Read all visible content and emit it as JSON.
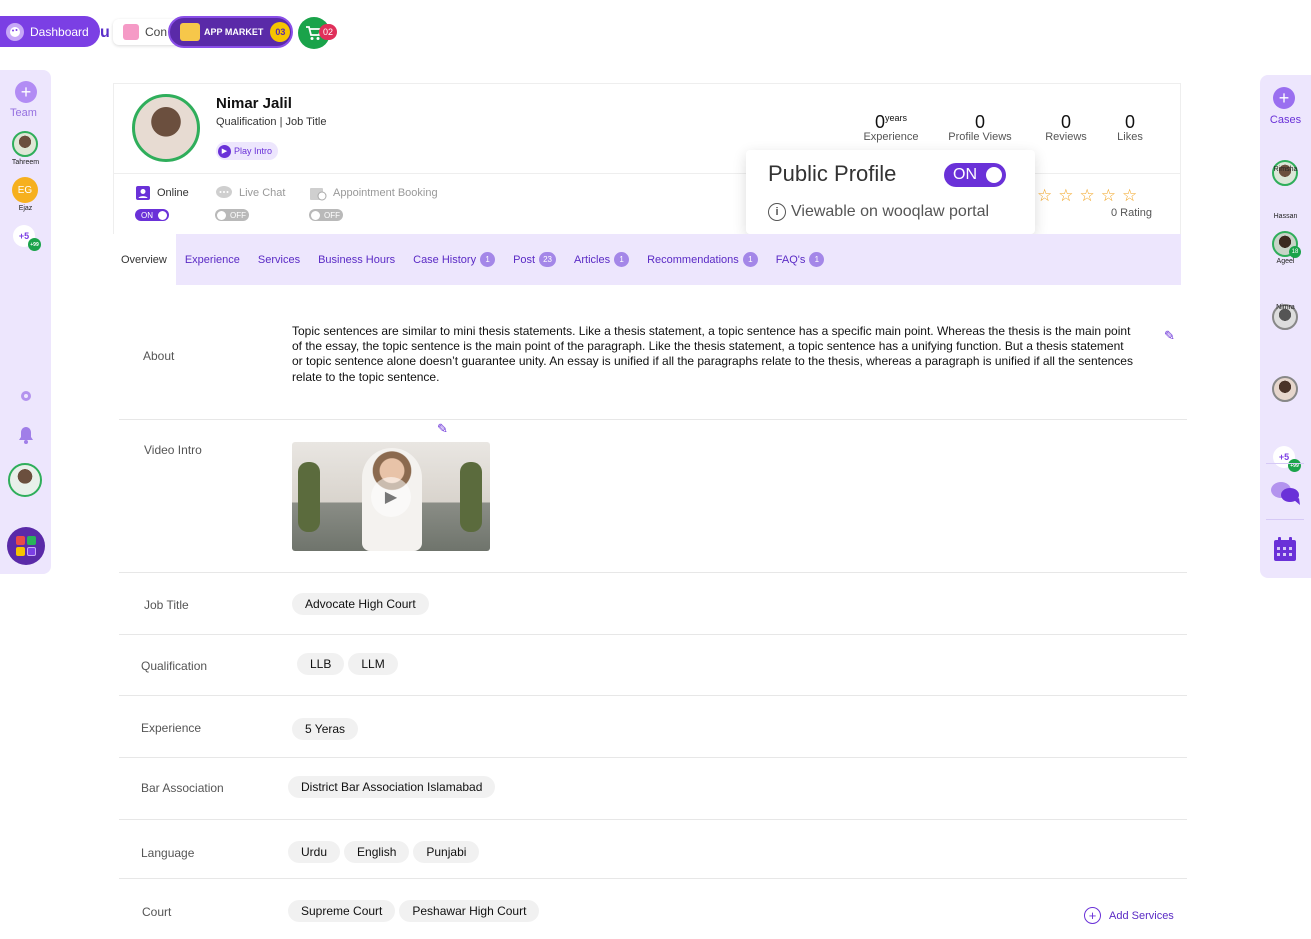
{
  "topbar": {
    "dashboard_label": "Dashboard",
    "logo_text": "u",
    "contacts_label": "Con",
    "app_market_label": "APP MARKET",
    "app_market_count": "03",
    "cart_count": "02"
  },
  "left_sidebar": {
    "team_label": "Team",
    "members": [
      {
        "name": "Tahreem",
        "initials": ""
      },
      {
        "name": "Ejaz",
        "initials": "EG"
      }
    ],
    "more_label": "+5",
    "more_sub": "+99"
  },
  "right_sidebar": {
    "cases_label": "Cases",
    "members": [
      {
        "name": "Rimsha"
      },
      {
        "name": "Hassan",
        "badge": "18"
      },
      {
        "name": "Ageel"
      },
      {
        "name": "Nimra"
      }
    ],
    "more_label": "+5",
    "more_sub": "+99"
  },
  "profile": {
    "name": "Nimar Jalil",
    "subtitle": "Qualification | Job Title",
    "play_intro": "Play Intro",
    "stats": [
      {
        "value": "0",
        "sup": "years",
        "label": "Experience"
      },
      {
        "value": "0",
        "sup": "",
        "label": "Profile Views"
      },
      {
        "value": "0",
        "sup": "",
        "label": "Reviews"
      },
      {
        "value": "0",
        "sup": "",
        "label": "Likes"
      }
    ],
    "statuses": [
      {
        "label": "Online",
        "toggle": "ON"
      },
      {
        "label": "Live Chat",
        "toggle": "OFF"
      },
      {
        "label": "Appointment Booking",
        "toggle": "OFF"
      }
    ],
    "stars": "☆☆☆☆☆",
    "rating_text": "0  Rating"
  },
  "popup": {
    "title": "Public Profile",
    "toggle": "ON",
    "info": "Viewable on wooqlaw portal"
  },
  "tabs": [
    {
      "label": "Overview",
      "badge": ""
    },
    {
      "label": "Experience",
      "badge": ""
    },
    {
      "label": "Services",
      "badge": ""
    },
    {
      "label": "Business Hours",
      "badge": ""
    },
    {
      "label": "Case History",
      "badge": "1"
    },
    {
      "label": "Post",
      "badge": "23"
    },
    {
      "label": "Articles",
      "badge": "1"
    },
    {
      "label": "Recommendations",
      "badge": "1"
    },
    {
      "label": "FAQ's",
      "badge": "1"
    }
  ],
  "details": {
    "about_label": "About",
    "about_text": "Topic sentences are similar to mini thesis statements. Like a thesis statement, a topic sentence has a specific main point. Whereas the thesis is the main point of the essay, the topic sentence is the main point of the paragraph. Like the thesis statement, a topic sentence has a unifying function. But a thesis statement or topic sentence alone doesn’t guarantee unity. An essay is unified if all the paragraphs relate to the thesis, whereas a paragraph is unified if all the sentences relate to the topic sentence.",
    "video_label": "Video Intro",
    "job_title_label": "Job Title",
    "job_title": [
      "Advocate High Court"
    ],
    "qualification_label": "Qualification",
    "qualification": [
      "LLB",
      "LLM"
    ],
    "experience_label": "Experience",
    "experience": [
      "5 Yeras"
    ],
    "bar_label": "Bar Association",
    "bar": [
      "District Bar Association Islamabad"
    ],
    "language_label": "Language",
    "language": [
      "Urdu",
      "English",
      "Punjabi"
    ],
    "court_label": "Court",
    "court": [
      "Supreme Court",
      "Peshawar High Court"
    ],
    "add_services": "Add Services"
  }
}
